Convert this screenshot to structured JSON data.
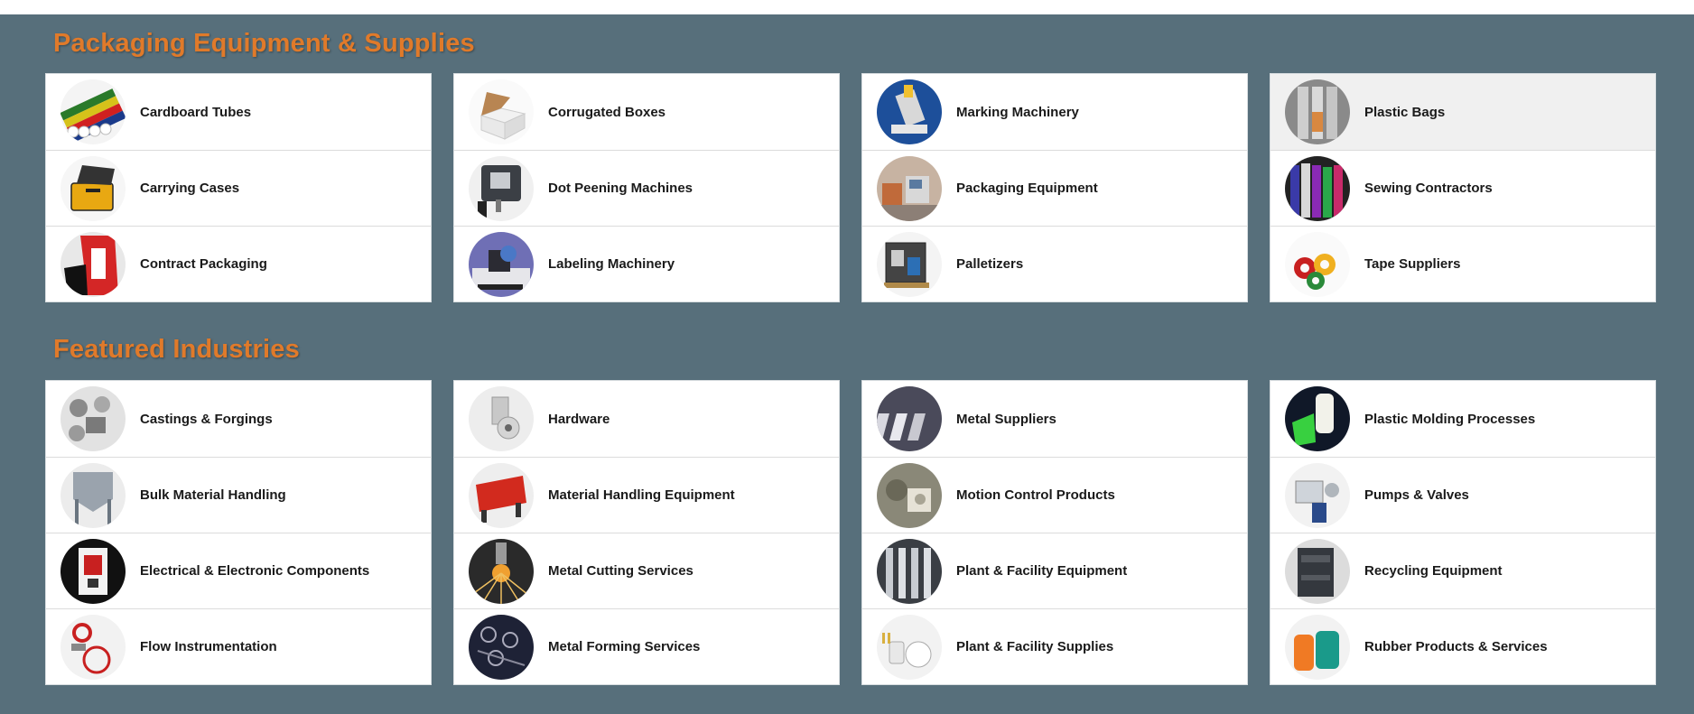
{
  "sections": [
    {
      "title": "Packaging Equipment & Supplies",
      "columns": [
        [
          {
            "label": "Cardboard Tubes",
            "icon": "cardboard-tubes-icon"
          },
          {
            "label": "Carrying Cases",
            "icon": "carrying-case-icon"
          },
          {
            "label": "Contract Packaging",
            "icon": "contract-packaging-icon"
          }
        ],
        [
          {
            "label": "Corrugated Boxes",
            "icon": "corrugated-box-icon"
          },
          {
            "label": "Dot Peening Machines",
            "icon": "dot-peening-machine-icon"
          },
          {
            "label": "Labeling Machinery",
            "icon": "labeling-machine-icon"
          }
        ],
        [
          {
            "label": "Marking Machinery",
            "icon": "marking-machine-icon"
          },
          {
            "label": "Packaging Equipment",
            "icon": "packaging-equipment-icon"
          },
          {
            "label": "Palletizers",
            "icon": "palletizer-icon"
          }
        ],
        [
          {
            "label": "Plastic Bags",
            "icon": "plastic-bags-icon"
          },
          {
            "label": "Sewing Contractors",
            "icon": "sewing-contractors-icon"
          },
          {
            "label": "Tape Suppliers",
            "icon": "tape-icon"
          }
        ]
      ]
    },
    {
      "title": "Featured Industries",
      "columns": [
        [
          {
            "label": "Castings & Forgings",
            "icon": "castings-icon"
          },
          {
            "label": "Bulk Material Handling",
            "icon": "bulk-handling-icon"
          },
          {
            "label": "Electrical & Electronic Components",
            "icon": "electrical-components-icon"
          },
          {
            "label": "Flow Instrumentation",
            "icon": "flow-instrument-icon"
          }
        ],
        [
          {
            "label": "Hardware",
            "icon": "hardware-icon"
          },
          {
            "label": "Material Handling Equipment",
            "icon": "material-handling-icon"
          },
          {
            "label": "Metal Cutting Services",
            "icon": "metal-cutting-icon"
          },
          {
            "label": "Metal Forming Services",
            "icon": "metal-forming-icon"
          }
        ],
        [
          {
            "label": "Metal Suppliers",
            "icon": "metal-suppliers-icon"
          },
          {
            "label": "Motion Control Products",
            "icon": "motion-control-icon"
          },
          {
            "label": "Plant & Facility Equipment",
            "icon": "plant-equipment-icon"
          },
          {
            "label": "Plant & Facility Supplies",
            "icon": "plant-supplies-icon"
          }
        ],
        [
          {
            "label": "Plastic Molding Processes",
            "icon": "plastic-molding-icon"
          },
          {
            "label": "Pumps & Valves",
            "icon": "pumps-valves-icon"
          },
          {
            "label": "Recycling Equipment",
            "icon": "recycling-equipment-icon"
          },
          {
            "label": "Rubber Products & Services",
            "icon": "rubber-products-icon"
          }
        ]
      ]
    }
  ],
  "colors": {
    "page_background": "#576f7b",
    "heading": "#e07a2a",
    "card_background": "#ffffff",
    "hover_row": "#f0f0f0"
  }
}
